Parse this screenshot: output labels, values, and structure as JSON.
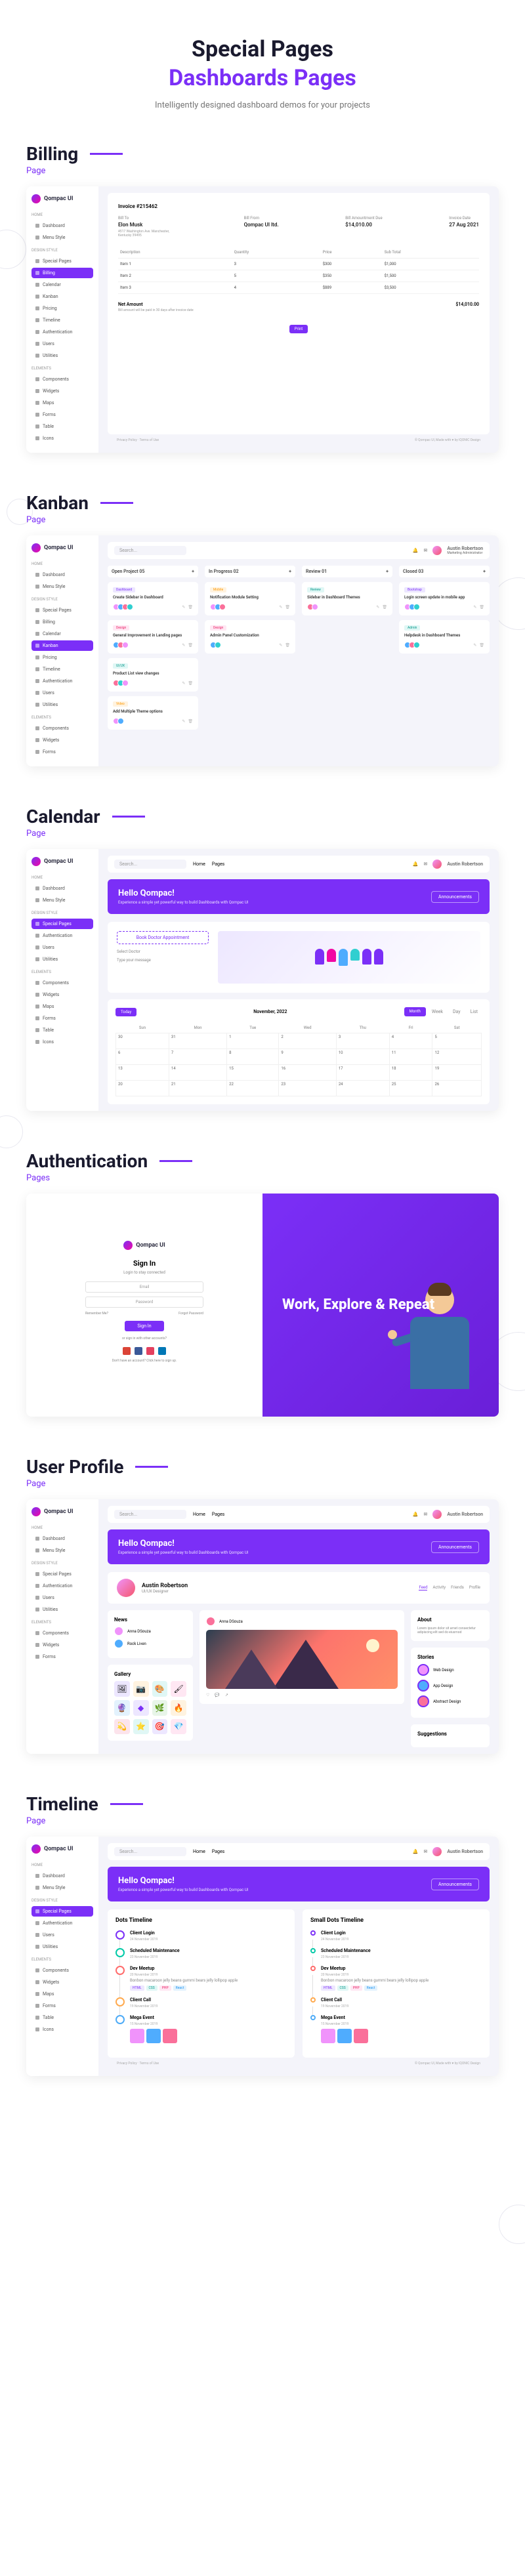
{
  "header": {
    "title": "Special Pages",
    "subtitle": "Dashboards Pages",
    "desc": "Intelligently designed dashboard demos for your projects"
  },
  "brand": "Qompac UI",
  "sections": {
    "billing": {
      "title": "Billing",
      "sub": "Page"
    },
    "kanban": {
      "title": "Kanban",
      "sub": "Page"
    },
    "calendar": {
      "title": "Calendar",
      "sub": "Page"
    },
    "auth": {
      "title": "Authentication",
      "sub": "Pages"
    },
    "profile": {
      "title": "User Profile",
      "sub": "Page"
    },
    "timeline": {
      "title": "Timeline",
      "sub": "Page"
    }
  },
  "nav": {
    "home": "Home",
    "dashboard": "Dashboard",
    "menu": "Menu Style",
    "special": "Special Pages",
    "billing": "Billing",
    "kanban": "Kanban",
    "calendar": "Calendar",
    "pricing": "Pricing",
    "timeline": "Timeline",
    "elements": "Elements",
    "components": "Components",
    "auth": "Authentication",
    "users": "Users",
    "utilities": "Utilities",
    "widgets": "Widgets",
    "maps": "Maps",
    "forms": "Forms",
    "tables": "Table",
    "icons": "Icons",
    "design": "Design Style"
  },
  "topbar": {
    "search": "Search...",
    "home": "Home",
    "pages": "Pages",
    "user": "Austin Robertson",
    "role": "Marketing Administrator"
  },
  "banner": {
    "title": "Hello Qompac!",
    "sub": "Experience a simple yet powerful way to build Dashboards with Qompac UI",
    "btn": "Announcements"
  },
  "billing": {
    "invoice": "Invoice #215462",
    "to": "Bill To",
    "name": "Elon Musk",
    "addr": "4517 Washington Ave. Manchester, Kentucky 39495",
    "from": "Bill From",
    "co": "Qompac UI ltd.",
    "amtdue_l": "Bill Amountment Due",
    "amtdue": "$14,010.00",
    "date_l": "Invoice Date",
    "date": "27 Aug 2021",
    "th": [
      "Description",
      "Quantity",
      "Price",
      "Sub Total"
    ],
    "rows": [
      [
        "Item 1",
        "3",
        "$300",
        "$1,000"
      ],
      [
        "Item 2",
        "5",
        "$350",
        "$1,500"
      ],
      [
        "Item 3",
        "4",
        "$889",
        "$3,500"
      ]
    ],
    "net_l": "Net Amount",
    "net_note": "Bill amount will be paid in 30 days after invoice date",
    "total": "$14,010.00",
    "print": "Print"
  },
  "kanban": {
    "cols": [
      "Open Project 05",
      "In Progress 02",
      "Review 01",
      "Closed 03"
    ],
    "c1": [
      {
        "tag": "Dashboard",
        "title": "Create Sidebar in Dashboard"
      },
      {
        "tag": "Design",
        "title": "General Improvement in Landing pages"
      },
      {
        "tag": "UI/UX",
        "title": "Product List view changes"
      },
      {
        "tag": "Video",
        "title": "Add Multiple Theme options"
      }
    ],
    "c2": [
      {
        "tag": "Mobile",
        "title": "Notification Module Setting"
      },
      {
        "tag": "Design",
        "title": "Admin Panel Customization"
      }
    ],
    "c3": [
      {
        "tag": "Review",
        "title": "Sidebar in Dashboard Themes"
      }
    ],
    "c4": [
      {
        "tag": "Bootstrap",
        "title": "Login screen update in mobile app"
      },
      {
        "tag": "Admin",
        "title": "Helpdesk in Dashboard Themes"
      }
    ]
  },
  "calendar": {
    "book": "Book Doctor Appointment",
    "doctor": "Select Doctor",
    "message": "Type your message",
    "today": "Today",
    "month": "November, 2022",
    "views": [
      "Month",
      "Week",
      "Day",
      "List"
    ],
    "days": [
      "Sun",
      "Mon",
      "Tue",
      "Wed",
      "Thu",
      "Fri",
      "Sat"
    ]
  },
  "auth": {
    "signin": "Sign In",
    "sub": "Login to stay connected",
    "email": "Email",
    "pwd": "Password",
    "remember": "Remember Me?",
    "forgot": "Forgot Password",
    "btn": "Sign In",
    "or": "or sign in with other accounts?",
    "signup": "Don't have an account? Click here to sign up.",
    "hero": "Work, Explore & Repeat"
  },
  "profile": {
    "name": "Austin Robertson",
    "role": "UI/UX Designer",
    "tabs": [
      "Feed",
      "Activity",
      "Friends",
      "Profile"
    ],
    "news": "News",
    "friends": "Anna DSouza",
    "f2": "Rock Liven",
    "gallery": "Gallery",
    "about": "About",
    "abouttext": "Lorem ipsum dolor sit amet consectetur adipiscing elit sed do eiusmod",
    "stories": "Stories",
    "s1": "Web Design",
    "s2": "App Design",
    "s3": "Abstract Design",
    "suggest": "Suggestions"
  },
  "timeline": {
    "dots": "Dots Timeline",
    "small": "Small Dots Timeline",
    "t1": "Client Login",
    "t1d": "24 November 2019",
    "t2": "Scheduled Maintenance",
    "t2d": "23 November 2019",
    "t3": "Dev Meetup",
    "t3d": "20 November 2019",
    "t3text": "Bonbon macaroon jelly beans gummi bears jelly lollipop apple",
    "t4": "Client Call",
    "t4d": "19 November 2019",
    "t5": "Mega Event",
    "t5d": "15 November 2019",
    "b1": "HTML",
    "b2": "CSS",
    "b3": "PHP",
    "b4": "React"
  },
  "footer": {
    "left": "Privacy Policy · Terms of Use",
    "right": "© Qompac UI, Made with ♥ by IQONIC Design"
  }
}
